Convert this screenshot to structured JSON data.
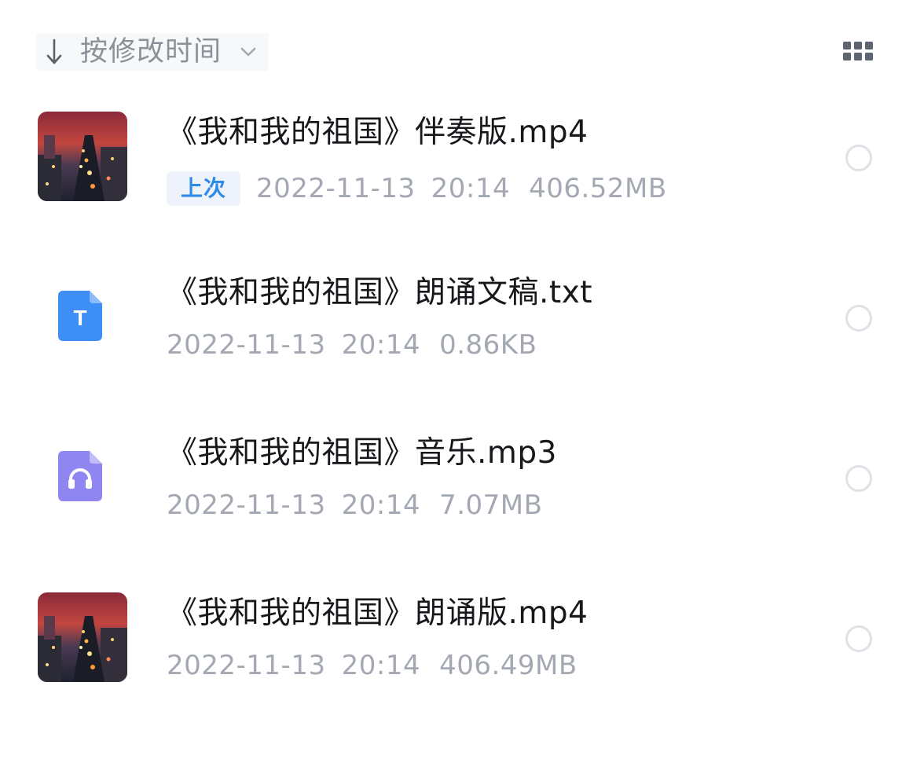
{
  "toolbar": {
    "sort_label": "按修改时间",
    "sort_icon": "down-arrow-icon",
    "sort_dropdown_icon": "chevron-down-icon",
    "view_toggle_icon": "grid-view-icon"
  },
  "files": [
    {
      "name": "《我和我的祖国》伴奏版.mp4",
      "type": "video",
      "badge": "上次",
      "date": "2022-11-13",
      "time": "20:14",
      "size": "406.52MB"
    },
    {
      "name": "《我和我的祖国》朗诵文稿.txt",
      "type": "text",
      "icon_letter": "T",
      "date": "2022-11-13",
      "time": "20:14",
      "size": "0.86KB"
    },
    {
      "name": "《我和我的祖国》音乐.mp3",
      "type": "audio",
      "date": "2022-11-13",
      "time": "20:14",
      "size": "7.07MB"
    },
    {
      "name": "《我和我的祖国》朗诵版.mp4",
      "type": "video",
      "date": "2022-11-13",
      "time": "20:14",
      "size": "406.49MB"
    }
  ],
  "colors": {
    "text_primary": "#16181c",
    "text_secondary": "#a3a8b3",
    "badge_text": "#2f8be6",
    "badge_bg": "#eef3fb",
    "txt_icon": "#3d8ff5",
    "audio_icon": "#8f86f2"
  }
}
